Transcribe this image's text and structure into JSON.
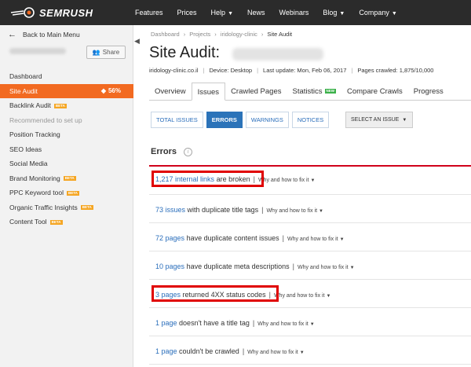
{
  "brand": {
    "name": "SEMRUSH"
  },
  "topnav": [
    "Features",
    "Prices",
    "Help",
    "News",
    "Webinars",
    "Blog",
    "Company"
  ],
  "sidebar": {
    "back_label": "Back to Main Menu",
    "share_label": "Share",
    "items": [
      {
        "label": "Dashboard"
      },
      {
        "label": "Site Audit",
        "value": "56%",
        "active": true
      },
      {
        "label": "Backlink Audit",
        "badge": "BETA"
      },
      {
        "label": "Recommended to set up",
        "muted": true
      },
      {
        "label": "Position Tracking"
      },
      {
        "label": "SEO Ideas"
      },
      {
        "label": "Social Media"
      },
      {
        "label": "Brand Monitoring",
        "badge": "BETA"
      },
      {
        "label": "PPC Keyword tool",
        "badge": "BETA"
      },
      {
        "label": "Organic Traffic Insights",
        "badge": "BETA"
      },
      {
        "label": "Content Tool",
        "badge": "BETA"
      }
    ]
  },
  "breadcrumb": [
    "Dashboard",
    "Projects",
    "iridology-clinic",
    "Site Audit"
  ],
  "page": {
    "title": "Site Audit:",
    "domain": "iridology-clinic.co.il",
    "device": "Device: Desktop",
    "last_update": "Last update: Mon, Feb 06, 2017",
    "pages_crawled": "Pages crawled: 1,875/10,000"
  },
  "tabs": [
    {
      "label": "Overview"
    },
    {
      "label": "Issues",
      "active": true
    },
    {
      "label": "Crawled Pages"
    },
    {
      "label": "Statistics",
      "badge": "NEW"
    },
    {
      "label": "Compare Crawls"
    },
    {
      "label": "Progress"
    }
  ],
  "filters": {
    "buttons": [
      "TOTAL ISSUES",
      "ERRORS",
      "WARNINGS",
      "NOTICES"
    ],
    "active": "ERRORS",
    "select_label": "SELECT AN ISSUE"
  },
  "errors": {
    "heading": "Errors",
    "why_label": "Why and how to fix it",
    "items": [
      {
        "link": "1,217 internal links",
        "text": "are broken",
        "highlighted": true
      },
      {
        "link": "73 issues",
        "text": "with duplicate title tags"
      },
      {
        "link": "72 pages",
        "text": "have duplicate content issues"
      },
      {
        "link": "10 pages",
        "text": "have duplicate meta descriptions"
      },
      {
        "link": "3 pages",
        "text": "returned 4XX status codes",
        "highlighted": true
      },
      {
        "link": "1 page",
        "text": "doesn't have a title tag"
      },
      {
        "link": "1 page",
        "text": "couldn't be crawled"
      }
    ]
  },
  "colors": {
    "accent": "#f26a21",
    "link": "#2a6ebb",
    "highlight": "#e00000",
    "topbar": "#2b2b2b"
  }
}
